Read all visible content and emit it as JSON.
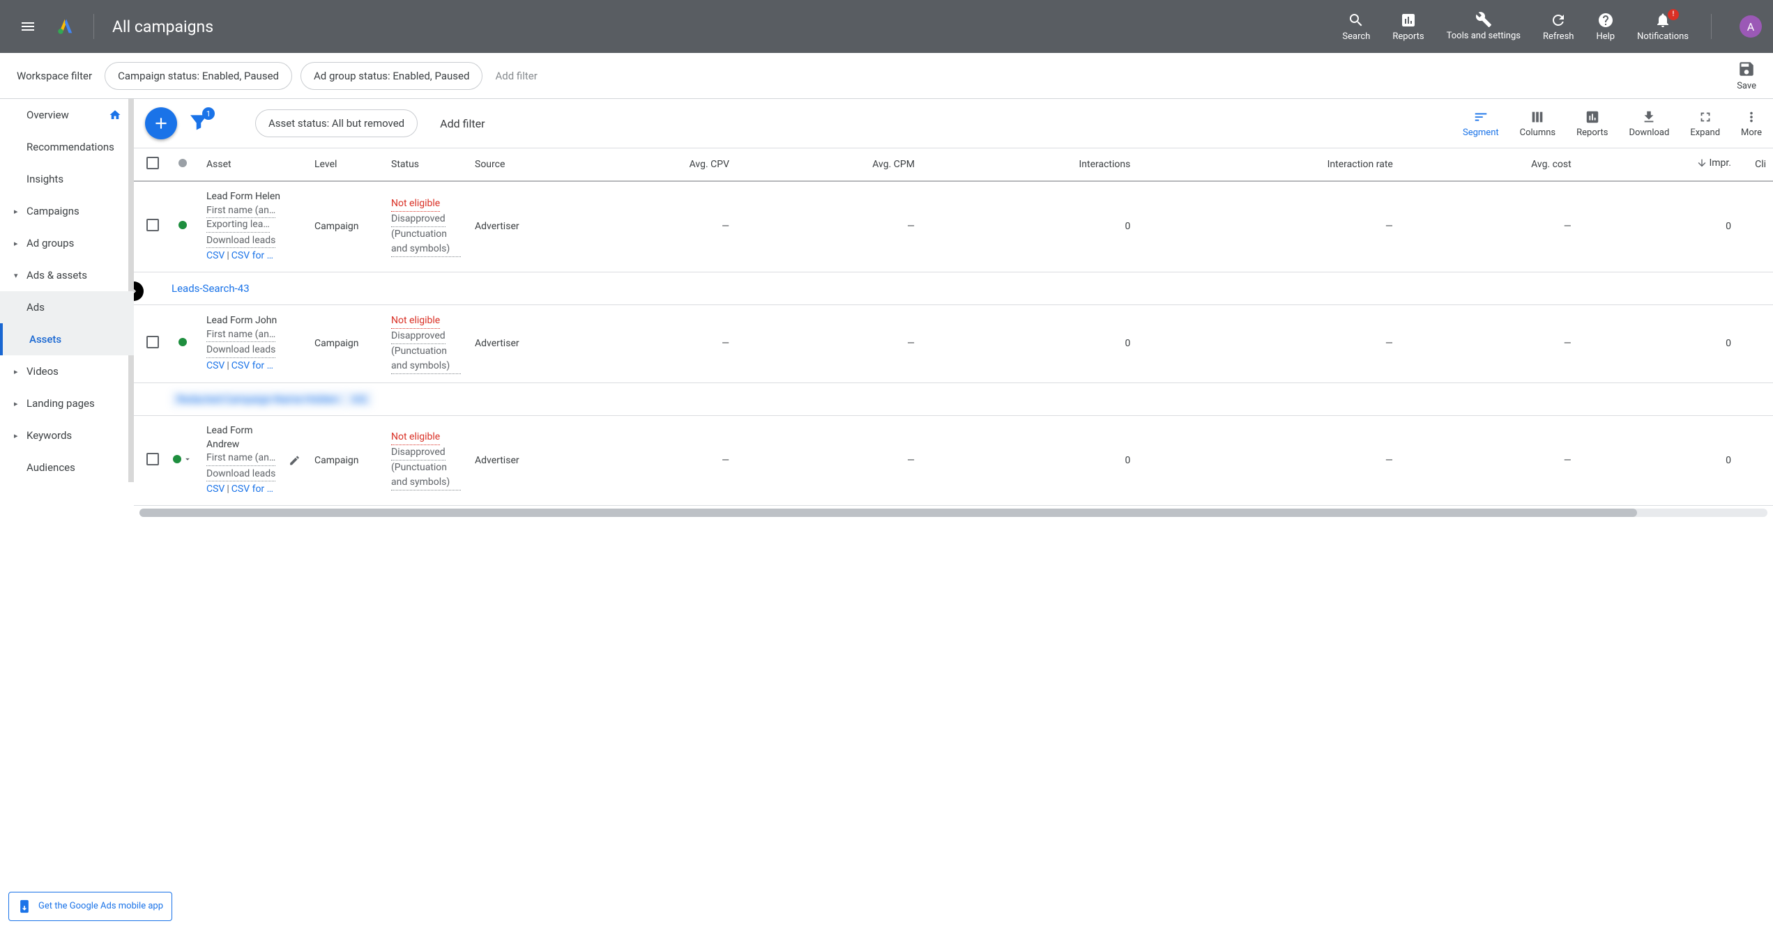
{
  "header": {
    "title": "All campaigns",
    "actions": {
      "search": "Search",
      "reports": "Reports",
      "tools": "Tools and settings",
      "refresh": "Refresh",
      "help": "Help",
      "notifications": "Notifications",
      "notif_badge": "!"
    },
    "avatar": "A"
  },
  "filter_bar": {
    "label": "Workspace filter",
    "chips": [
      "Campaign status: Enabled, Paused",
      "Ad group status: Enabled, Paused"
    ],
    "add_filter": "Add filter",
    "save": "Save"
  },
  "sidebar": {
    "items": [
      {
        "label": "Overview",
        "arrow": false,
        "home": true
      },
      {
        "label": "Recommendations",
        "arrow": false
      },
      {
        "label": "Insights",
        "arrow": false
      },
      {
        "label": "Campaigns",
        "arrow": true
      },
      {
        "label": "Ad groups",
        "arrow": true
      },
      {
        "label": "Ads & assets",
        "arrow": true,
        "expanded": true
      },
      {
        "label": "Ads",
        "sub": true
      },
      {
        "label": "Assets",
        "sub": true,
        "active": true
      },
      {
        "label": "Videos",
        "arrow": true
      },
      {
        "label": "Landing pages",
        "arrow": true
      },
      {
        "label": "Keywords",
        "arrow": true
      },
      {
        "label": "Audiences",
        "arrow": false
      }
    ],
    "promo": "Get the Google Ads mobile app"
  },
  "toolbar": {
    "filter_badge": "1",
    "asset_filter": "Asset status: All but removed",
    "add_filter": "Add filter",
    "actions": {
      "segment": "Segment",
      "columns": "Columns",
      "reports": "Reports",
      "download": "Download",
      "expand": "Expand",
      "more": "More"
    }
  },
  "table": {
    "columns": [
      "Asset",
      "Level",
      "Status",
      "Source",
      "Avg. CPV",
      "Avg. CPM",
      "Interactions",
      "Interaction rate",
      "Avg. cost",
      "Impr.",
      "Clicks"
    ],
    "sort_col": "Impr.",
    "rows": [
      {
        "type": "data",
        "dot": "green",
        "asset_title": "Lead Form Helen",
        "asset_sub": "First name (an…",
        "asset_extra": "Exporting lea…",
        "download_label": "Download leads",
        "csv1": "CSV",
        "csv2": "CSV for …",
        "level": "Campaign",
        "status_primary": "Not eligible",
        "status_secondary": "Disapproved",
        "status_reason": "(Punctuation and symbols)",
        "source": "Advertiser",
        "avg_cpv": "—",
        "avg_cpm": "—",
        "interactions": "0",
        "int_rate": "—",
        "avg_cost": "—",
        "impr": "0"
      },
      {
        "type": "group",
        "label": "Leads-Search-43"
      },
      {
        "type": "data",
        "dot": "green",
        "asset_title": "Lead Form John",
        "asset_sub": "First name (an…",
        "download_label": "Download leads",
        "csv1": "CSV",
        "csv2": "CSV for …",
        "level": "Campaign",
        "status_primary": "Not eligible",
        "status_secondary": "Disapproved",
        "status_reason": "(Punctuation and symbols)",
        "source": "Advertiser",
        "avg_cpv": "—",
        "avg_cpm": "—",
        "interactions": "0",
        "int_rate": "—",
        "avg_cost": "—",
        "impr": "0"
      },
      {
        "type": "group",
        "blur": true,
        "label": "Redacted-Campaign-Name-Hidden-",
        "suffix": "63|"
      },
      {
        "type": "data",
        "dot": "green",
        "dot_dropdown": true,
        "edit": true,
        "asset_title": "Lead Form Andrew",
        "asset_sub": "First name (an…",
        "download_label": "Download leads",
        "csv1": "CSV",
        "csv2": "CSV for …",
        "level": "Campaign",
        "status_primary": "Not eligible",
        "status_secondary": "Disapproved",
        "status_reason": "(Punctuation and symbols)",
        "source": "Advertiser",
        "avg_cpv": "—",
        "avg_cpm": "—",
        "interactions": "0",
        "int_rate": "—",
        "avg_cost": "—",
        "impr": "0"
      }
    ]
  }
}
